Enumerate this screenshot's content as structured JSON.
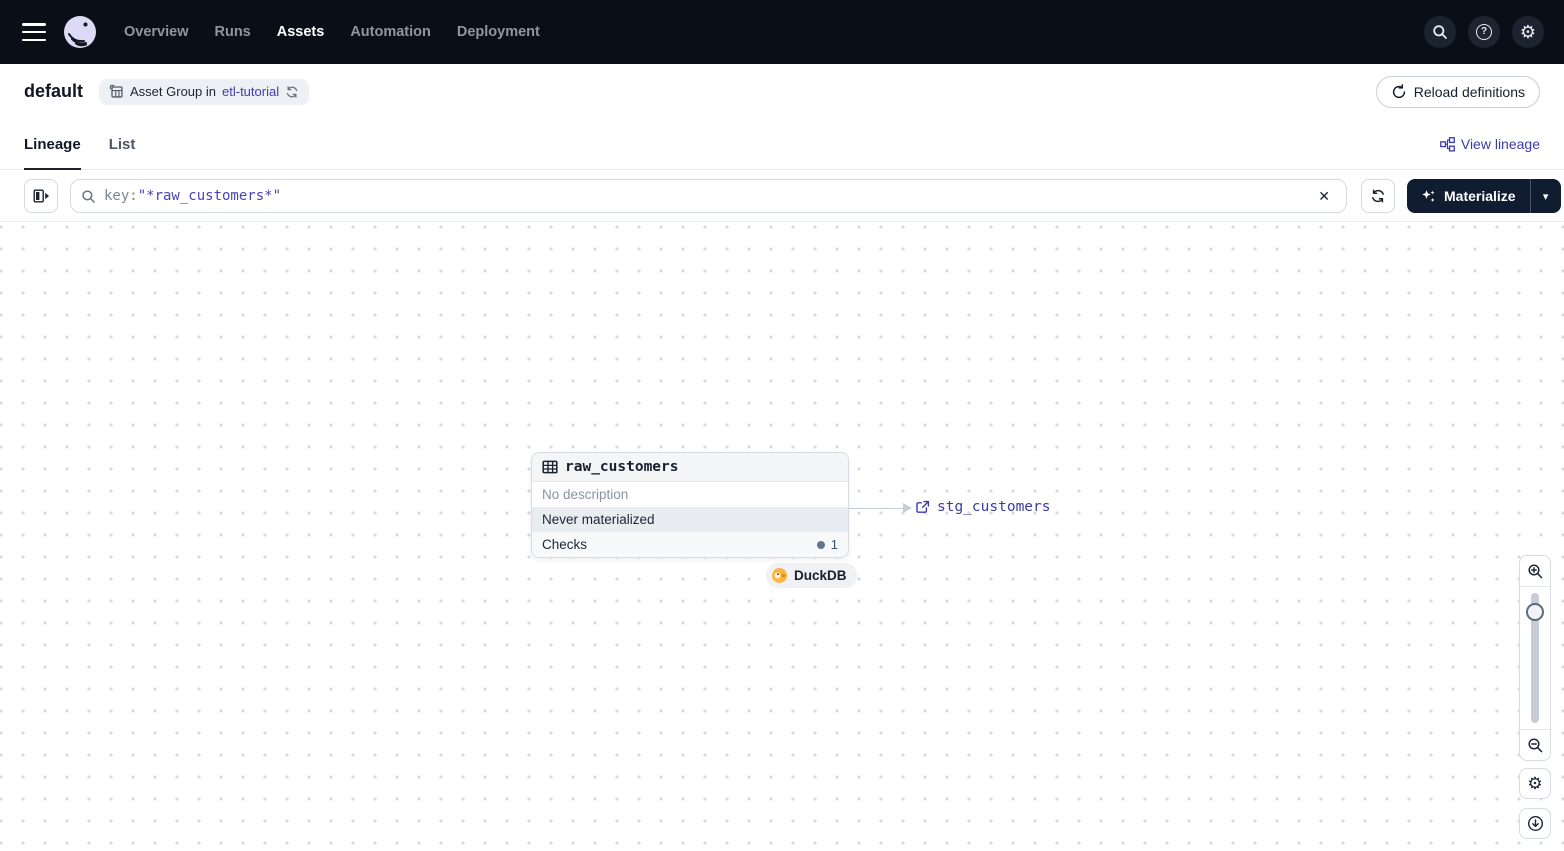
{
  "colors": {
    "nav_bg": "#0a0e17",
    "accent_link": "#403cb5",
    "dark_button_bg": "#101c30",
    "logo_lavender": "#dcdaf6",
    "duckdb_yellow": "#f9b63c",
    "status_dot": "#64748b"
  },
  "nav": {
    "items": [
      "Overview",
      "Runs",
      "Assets",
      "Automation",
      "Deployment"
    ],
    "active_item": "Assets"
  },
  "header": {
    "title": "default",
    "badge_prefix": "Asset Group in",
    "badge_link": "etl-tutorial",
    "reload_label": "Reload definitions"
  },
  "tabs": {
    "lineage": "Lineage",
    "list": "List",
    "view_lineage": "View lineage"
  },
  "filter": {
    "key_label": "key:",
    "key_value": "\"*raw_customers*\""
  },
  "toolbar": {
    "materialize_label": "Materialize"
  },
  "graph": {
    "asset": {
      "name": "raw_customers",
      "description": "No description",
      "status": "Never materialized",
      "checks_label": "Checks",
      "checks_count": "1",
      "kind_badge": "DuckDB"
    },
    "downstream": {
      "name": "stg_customers"
    }
  },
  "glyphs": {
    "gear": "⚙",
    "question": "?",
    "close": "✕",
    "caret_down": "▾"
  }
}
